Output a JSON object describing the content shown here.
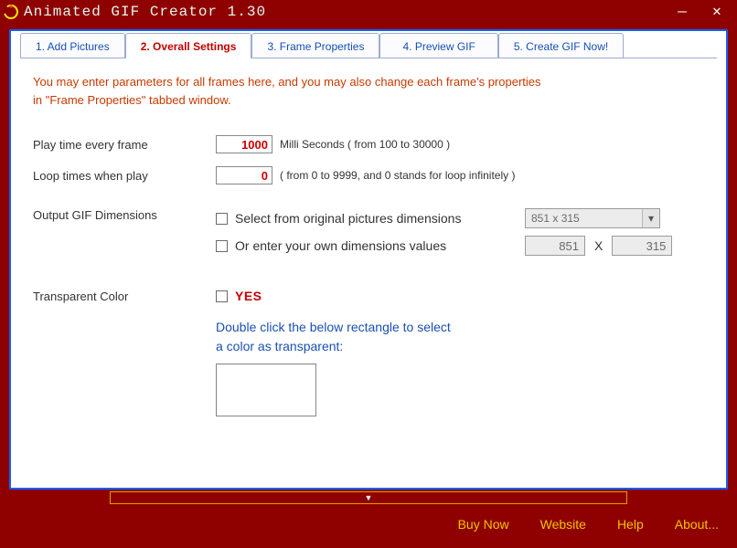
{
  "window": {
    "title": "Animated GIF Creator 1.30"
  },
  "tabs": [
    {
      "label": "1. Add Pictures"
    },
    {
      "label": "2. Overall Settings"
    },
    {
      "label": "3. Frame Properties"
    },
    {
      "label": "4. Preview GIF"
    },
    {
      "label": "5. Create GIF Now!"
    }
  ],
  "active_tab": 1,
  "intro_line1": "You may enter parameters for all frames here, and you may also change each frame's properties",
  "intro_line2": "in \"Frame Properties\" tabbed window.",
  "form": {
    "play_time_label": "Play time every frame",
    "play_time_value": "1000",
    "play_time_hint": "Milli Seconds ( from 100 to 30000 )",
    "loop_label": "Loop times when play",
    "loop_value": "0",
    "loop_hint": "( from 0 to 9999, and 0 stands for loop infinitely )",
    "dim_label": "Output GIF Dimensions",
    "dim_opt1": "Select from original pictures dimensions",
    "dim_select_value": "851 x 315",
    "dim_opt2": "Or enter your own dimensions values",
    "dim_w": "851",
    "dim_x": "X",
    "dim_h": "315",
    "trans_label": "Transparent Color",
    "trans_yes": "YES",
    "trans_instr_l1": "Double click the below rectangle to select",
    "trans_instr_l2": "a color as transparent:"
  },
  "footer": {
    "buy": "Buy Now",
    "website": "Website",
    "help": "Help",
    "about": "About..."
  }
}
